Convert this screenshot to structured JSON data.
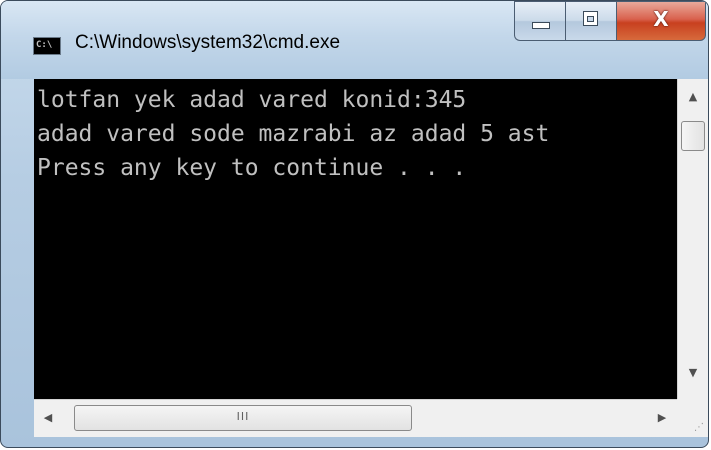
{
  "window": {
    "title": "C:\\Windows\\system32\\cmd.exe",
    "icon_name": "cmd-icon",
    "icon_text": "C:\\",
    "close_glyph": "X"
  },
  "console": {
    "lines": [
      "lotfan yek adad vared konid:345",
      "adad vared sode mazrabi az adad 5 ast",
      "Press any key to continue . . ."
    ],
    "text_color": "#c0c0c0",
    "background": "#000000"
  },
  "scrollbars": {
    "up_arrow": "▲",
    "down_arrow": "▼",
    "left_arrow": "◀",
    "right_arrow": "▶",
    "grip": "III",
    "size_grip": "⋰"
  }
}
